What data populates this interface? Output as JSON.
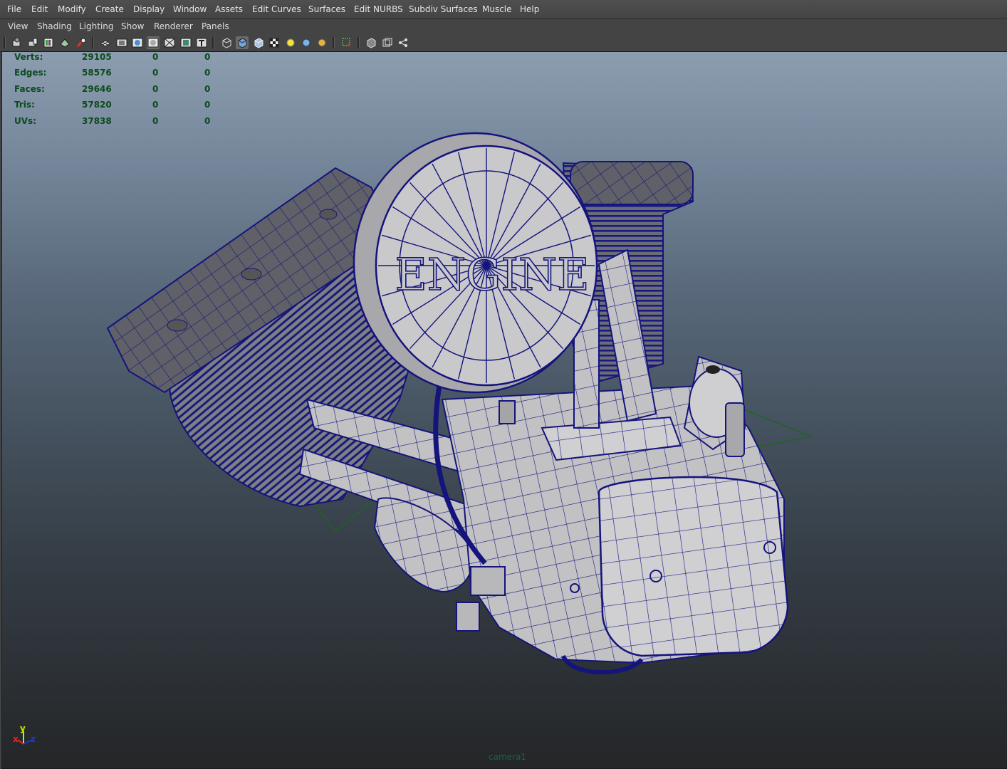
{
  "menubar": [
    "File",
    "Edit",
    "Modify",
    "Create",
    "Display",
    "Window",
    "Assets",
    "Edit Curves",
    "Surfaces",
    "Edit NURBS",
    "Subdiv Surfaces",
    "Muscle",
    "Help"
  ],
  "panel_menu": [
    "View",
    "Shading",
    "Lighting",
    "Show",
    "Renderer",
    "Panels"
  ],
  "toolbar_icons": [
    "camera-attributes-icon",
    "camera-bookmark-icon",
    "image-plane-icon",
    "2d-pan-zoom-icon",
    "grease-pencil-icon",
    "grid-icon",
    "film-gate-icon",
    "resolution-gate-icon",
    "gate-mask-icon",
    "field-chart-icon",
    "safe-action-icon",
    "safe-title-icon",
    "wireframe-icon",
    "smooth-shade-icon",
    "wireframe-on-shaded-icon",
    "textured-icon",
    "default-light-icon",
    "all-lights-icon",
    "shadows-icon",
    "isolate-select-icon",
    "xray-icon",
    "xray-joints-icon",
    "component-xray-icon"
  ],
  "hud": {
    "rows": [
      {
        "label": "Verts:",
        "v1": "29105",
        "v2": "0",
        "v3": "0"
      },
      {
        "label": "Edges:",
        "v1": "58576",
        "v2": "0",
        "v3": "0"
      },
      {
        "label": "Faces:",
        "v1": "29646",
        "v2": "0",
        "v3": "0"
      },
      {
        "label": "Tris:",
        "v1": "57820",
        "v2": "0",
        "v3": "0"
      },
      {
        "label": "UVs:",
        "v1": "37838",
        "v2": "0",
        "v3": "0"
      }
    ]
  },
  "model": {
    "air_cleaner_text": "ENGINE",
    "wire_color": "#14147c",
    "surface_color": "#b9b9bb"
  },
  "viewport": {
    "camera_label": "camera1",
    "axis": {
      "x": "x",
      "y": "y",
      "z": "z"
    }
  },
  "colors": {
    "hud_text": "#0d4a1c",
    "camera_label": "#0f6a3a",
    "menu_bg": "#444444",
    "menu_text": "#e6e6e6"
  }
}
